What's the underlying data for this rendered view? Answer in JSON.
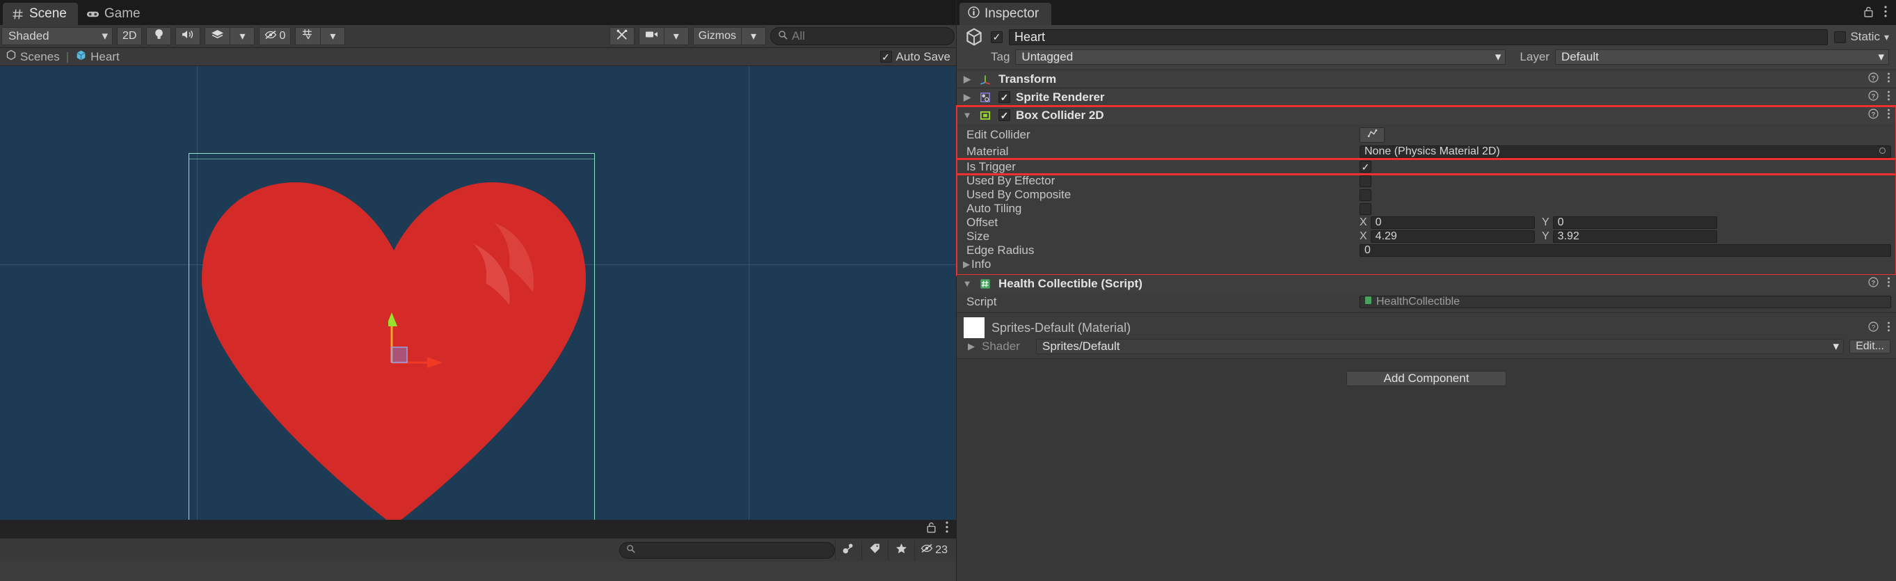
{
  "scene_panel": {
    "tabs": [
      {
        "label": "Scene",
        "icon": "grid-hash-icon",
        "active": true
      },
      {
        "label": "Game",
        "icon": "gamepad-icon",
        "active": false
      }
    ],
    "toolbar": {
      "shading_mode": "Shaded",
      "mode_2d": "2D",
      "lighting_icon": "lightbulb-icon",
      "audio_icon": "speaker-icon",
      "fx_icon": "effects-layers-icon",
      "fx_dropdown_icon": "chevron-down-icon",
      "hidden_count": "0",
      "hidden_icon": "eye-slash-icon",
      "grid_icon": "grid-axis-icon",
      "grid_dropdown_icon": "chevron-down-icon",
      "tools_icon": "wrench-screwdriver-icon",
      "camera_icon": "camera-icon",
      "camera_dropdown_icon": "chevron-down-icon",
      "gizmos_label": "Gizmos",
      "gizmos_dropdown_icon": "chevron-down-icon",
      "search_placeholder": "All",
      "search_icon": "search-icon"
    },
    "breadcrumb": {
      "root": "Scenes",
      "root_icon": "unity-logo-icon",
      "separator": "|",
      "current": "Heart",
      "current_icon": "prefab-cube-icon",
      "auto_save_label": "Auto Save",
      "auto_save_checked": true
    },
    "viewport": {
      "background_color": "#1e3b55",
      "sprite_color": "#d42a28",
      "collider_outline_color": "#8fe4c8",
      "gizmo_x_axis_color": "#f03a26",
      "gizmo_y_axis_color": "#97e02d",
      "gizmo_center_color": "#7b86d8"
    },
    "status": {
      "lock_icon": "lock-icon",
      "menu_icon": "kebab-menu-icon",
      "search_placeholder": "",
      "search_icon": "search-icon",
      "audio_btn_icon": "audio-mixer-icon",
      "tag_btn_icon": "tag-icon",
      "favorite_btn_icon": "star-icon",
      "hidden_btn_icon": "eye-slash-icon",
      "hidden_count": "23"
    }
  },
  "inspector": {
    "tab_label": "Inspector",
    "tab_icon": "info-circle-icon",
    "lock_icon": "lock-icon",
    "menu_icon": "kebab-menu-icon",
    "game_object": {
      "icon": "prefab-cube-icon",
      "enabled": true,
      "name": "Heart",
      "static_label": "Static",
      "static_checked": false,
      "static_dropdown_icon": "chevron-down-icon",
      "tag_label": "Tag",
      "tag_value": "Untagged",
      "layer_label": "Layer",
      "layer_value": "Default"
    },
    "components": [
      {
        "name": "Transform",
        "icon": "transform-axis-icon",
        "expanded": false,
        "has_checkbox": false,
        "help_icon": "help-circle-icon",
        "menu_icon": "kebab-menu-icon"
      },
      {
        "name": "Sprite Renderer",
        "icon": "sprite-renderer-icon",
        "expanded": false,
        "has_checkbox": true,
        "enabled": true,
        "help_icon": "help-circle-icon",
        "menu_icon": "kebab-menu-icon"
      },
      {
        "name": "Box Collider 2D",
        "icon": "box-collider-2d-icon",
        "expanded": true,
        "has_checkbox": true,
        "enabled": true,
        "highlighted": true,
        "help_icon": "help-circle-icon",
        "menu_icon": "kebab-menu-icon",
        "properties": {
          "edit_collider_label": "Edit Collider",
          "edit_collider_btn_icon": "edit-collider-icon",
          "material_label": "Material",
          "material_value": "None (Physics Material 2D)",
          "material_picker_icon": "object-picker-icon",
          "is_trigger_label": "Is Trigger",
          "is_trigger_checked": true,
          "is_trigger_highlighted": true,
          "used_by_effector_label": "Used By Effector",
          "used_by_effector_checked": false,
          "used_by_composite_label": "Used By Composite",
          "used_by_composite_checked": false,
          "auto_tiling_label": "Auto Tiling",
          "auto_tiling_checked": false,
          "offset_label": "Offset",
          "offset_x_axis": "X",
          "offset_x": "0",
          "offset_y_axis": "Y",
          "offset_y": "0",
          "size_label": "Size",
          "size_x_axis": "X",
          "size_x": "4.29",
          "size_y_axis": "Y",
          "size_y": "3.92",
          "edge_radius_label": "Edge Radius",
          "edge_radius": "0",
          "info_label": "Info"
        }
      },
      {
        "name": "Health Collectible (Script)",
        "icon": "cs-script-icon",
        "expanded": true,
        "has_checkbox": false,
        "help_icon": "help-circle-icon",
        "menu_icon": "kebab-menu-icon",
        "properties": {
          "script_label": "Script",
          "script_value": "HealthCollectible",
          "script_icon": "cs-file-icon"
        }
      }
    ],
    "material_preview": {
      "title": "Sprites-Default (Material)",
      "swatch_color": "#ffffff",
      "shader_label": "Shader",
      "shader_value": "Sprites/Default",
      "shader_dropdown_icon": "chevron-down-icon",
      "edit_label": "Edit...",
      "help_icon": "help-circle-icon",
      "menu_icon": "kebab-menu-icon"
    },
    "add_component_label": "Add Component"
  }
}
